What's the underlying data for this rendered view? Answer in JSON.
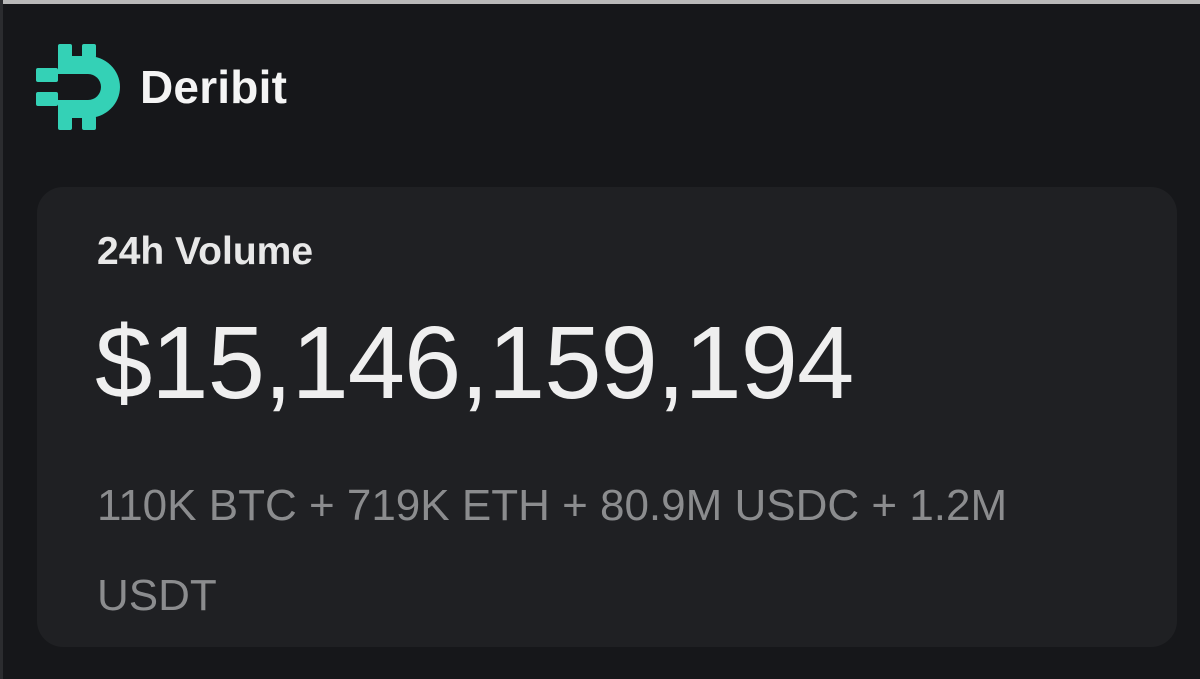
{
  "brand": {
    "name": "Deribit",
    "logo_icon": "deribit-logo-icon",
    "accent_color": "#34d1b6"
  },
  "card": {
    "title": "24h Volume",
    "value": "$15,146,159,194",
    "breakdown": "110K BTC + 719K ETH + 80.9M USDC + 1.2M USDT"
  },
  "colors": {
    "background": "#16171a",
    "card": "#1f2023",
    "text_primary": "#efefef",
    "text_secondary": "#8b8c8e"
  }
}
